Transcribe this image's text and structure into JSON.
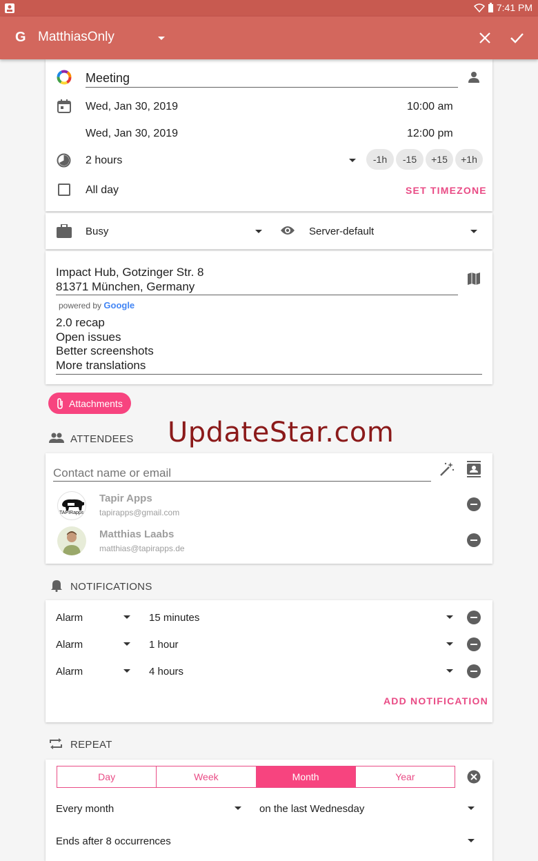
{
  "statusbar": {
    "time": "7:41 PM"
  },
  "appbar": {
    "logo": "G",
    "account": "MatthiasOnly"
  },
  "event": {
    "title": "Meeting",
    "start_date": "Wed, Jan 30, 2019",
    "start_time": "10:00 am",
    "end_date": "Wed, Jan 30, 2019",
    "end_time": "12:00 pm",
    "duration": "2 hours",
    "chips": [
      "-1h",
      "-15",
      "+15",
      "+1h"
    ],
    "all_day_label": "All day",
    "set_timezone": "SET TIMEZONE"
  },
  "availability": {
    "status": "Busy",
    "visibility": "Server-default"
  },
  "location": {
    "line1": "Impact Hub, Gotzinger Str. 8",
    "line2": "81371 München, Germany",
    "powered_by": "powered by",
    "google": "Google"
  },
  "description": [
    "2.0 recap",
    "Open issues",
    "Better screenshots",
    "More translations"
  ],
  "attachments_label": "Attachments",
  "watermark": "UpdateStar.com",
  "attendees": {
    "header": "ATTENDEES",
    "placeholder": "Contact name or email",
    "people": [
      {
        "name": "Tapir Apps",
        "email": "tapirapps@gmail.com",
        "avatar_text": "TAPIRapps"
      },
      {
        "name": "Matthias Laabs",
        "email": "matthias@tapirapps.de",
        "avatar_text": ""
      }
    ]
  },
  "notifications": {
    "header": "NOTIFICATIONS",
    "items": [
      {
        "type": "Alarm",
        "time": "15 minutes"
      },
      {
        "type": "Alarm",
        "time": "1 hour"
      },
      {
        "type": "Alarm",
        "time": "4 hours"
      }
    ],
    "add_label": "ADD NOTIFICATION"
  },
  "repeat": {
    "header": "REPEAT",
    "tabs": [
      "Day",
      "Week",
      "Month",
      "Year"
    ],
    "active_tab": "Month",
    "frequency": "Every month",
    "rule": "on the last Wednesday",
    "ends": "Ends after 8 occurrences"
  },
  "colors": {
    "appbar": "#d3675d",
    "statusbar": "#c85a50",
    "accent": "#f7447f",
    "accent_text": "#e94b85"
  }
}
